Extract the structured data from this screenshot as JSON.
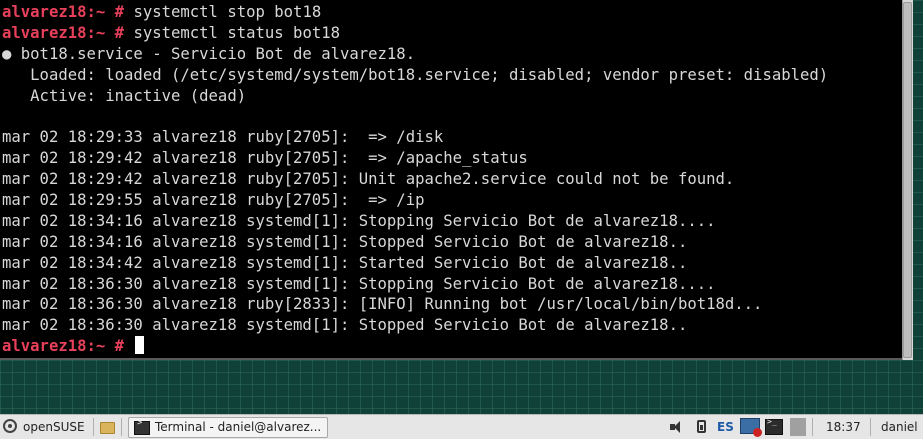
{
  "terminal": {
    "prompt": "alvarez18:~ #",
    "lines": [
      {
        "prompt": "alvarez18:~ #",
        "text": " systemctl stop bot18"
      },
      {
        "prompt": "alvarez18:~ #",
        "text": " systemctl status bot18"
      },
      {
        "prompt": "",
        "text": "● bot18.service - Servicio Bot de alvarez18."
      },
      {
        "prompt": "",
        "text": "   Loaded: loaded (/etc/systemd/system/bot18.service; disabled; vendor preset: disabled)"
      },
      {
        "prompt": "",
        "text": "   Active: inactive (dead)"
      },
      {
        "prompt": "",
        "text": ""
      },
      {
        "prompt": "",
        "text": "mar 02 18:29:33 alvarez18 ruby[2705]:  => /disk"
      },
      {
        "prompt": "",
        "text": "mar 02 18:29:42 alvarez18 ruby[2705]:  => /apache_status"
      },
      {
        "prompt": "",
        "text": "mar 02 18:29:42 alvarez18 ruby[2705]: Unit apache2.service could not be found."
      },
      {
        "prompt": "",
        "text": "mar 02 18:29:55 alvarez18 ruby[2705]:  => /ip"
      },
      {
        "prompt": "",
        "text": "mar 02 18:34:16 alvarez18 systemd[1]: Stopping Servicio Bot de alvarez18...."
      },
      {
        "prompt": "",
        "text": "mar 02 18:34:16 alvarez18 systemd[1]: Stopped Servicio Bot de alvarez18.."
      },
      {
        "prompt": "",
        "text": "mar 02 18:34:42 alvarez18 systemd[1]: Started Servicio Bot de alvarez18.."
      },
      {
        "prompt": "",
        "text": "mar 02 18:36:30 alvarez18 systemd[1]: Stopping Servicio Bot de alvarez18...."
      },
      {
        "prompt": "",
        "text": "mar 02 18:36:30 alvarez18 ruby[2833]: [INFO] Running bot /usr/local/bin/bot18d..."
      },
      {
        "prompt": "",
        "text": "mar 02 18:36:30 alvarez18 systemd[1]: Stopped Servicio Bot de alvarez18.."
      },
      {
        "prompt": "alvarez18:~ #",
        "text": " "
      }
    ],
    "prompt_color": "#e8405a",
    "text_color": "#d8d8d8",
    "background": "#000000"
  },
  "taskbar": {
    "start_label": "openSUSE",
    "task_label": "Terminal - daniel@alvarez...",
    "keyboard_layout": "ES",
    "clock": "18:37",
    "user": "daniel",
    "icons": [
      "opensuse-icon",
      "folder-icon",
      "terminal-icon",
      "volume-icon",
      "battery-icon",
      "network-icon",
      "terminal-tray-icon"
    ]
  }
}
